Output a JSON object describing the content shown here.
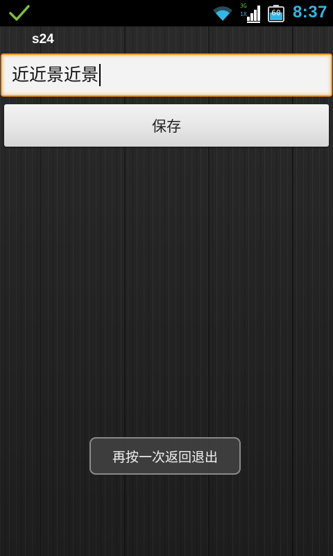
{
  "status_bar": {
    "notification_icon": "checkmark-icon",
    "network_3g": "3G",
    "network_1x": "1X",
    "battery_level": "60",
    "time": "8:37",
    "colors": {
      "check": "#7fbf3f",
      "wifi": "#33b5e5",
      "clock": "#33b5e5",
      "network_3g": "#67c23a",
      "network_1x": "#33b5e5"
    }
  },
  "app": {
    "title": "s24"
  },
  "edit_field": {
    "value": "近近景近景",
    "focused": true,
    "focus_color": "#ff9a1a"
  },
  "save_button": {
    "label": "保存"
  },
  "toast": {
    "message": "再按一次返回退出"
  }
}
